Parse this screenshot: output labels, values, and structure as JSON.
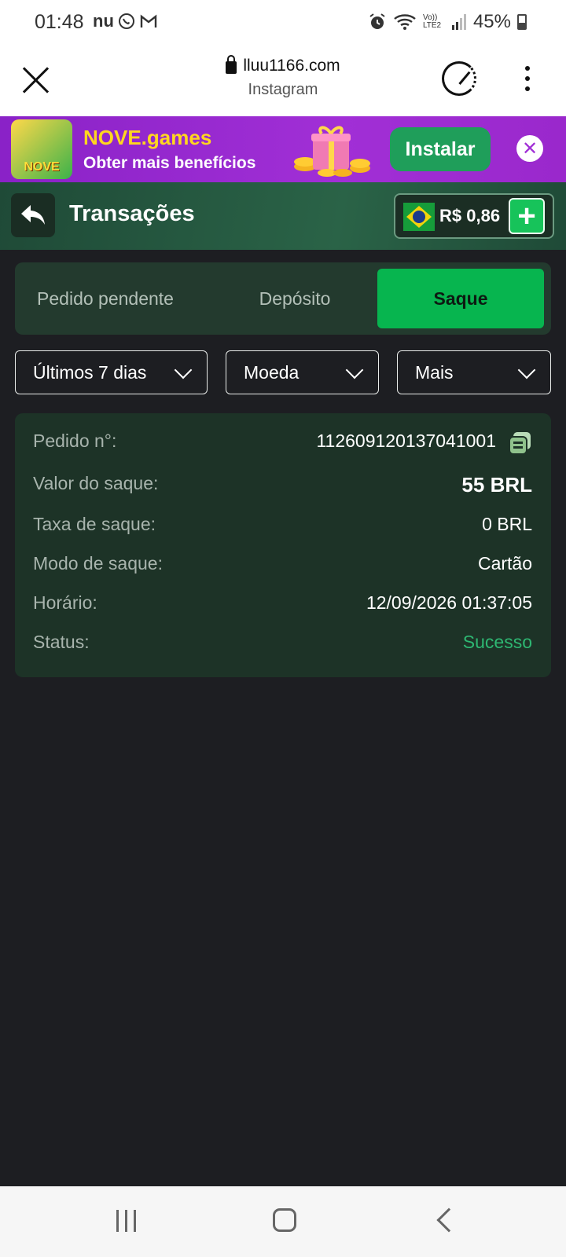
{
  "status_bar": {
    "time": "01:48",
    "left_icons": "nu",
    "lte_label": "Vo)) LTE2",
    "battery": "45%"
  },
  "browser": {
    "url": "lluu1166.com",
    "subtitle": "Instagram"
  },
  "promo": {
    "logo_text": "NOVE",
    "title": "NOVE.games",
    "subtitle": "Obter mais benefícios",
    "install_label": "Instalar"
  },
  "header": {
    "title": "Transações",
    "balance": "R$ 0,86"
  },
  "tabs": [
    {
      "label": "Pedido pendente"
    },
    {
      "label": "Depósito"
    },
    {
      "label": "Saque"
    }
  ],
  "filters": {
    "days": "Últimos 7 dias",
    "currency": "Moeda",
    "more": "Mais"
  },
  "transaction": {
    "order_label": "Pedido n°:",
    "order_value": "112609120137041001",
    "amount_label": "Valor do saque:",
    "amount_value": "55 BRL",
    "fee_label": "Taxa de saque:",
    "fee_value": "0 BRL",
    "mode_label": "Modo de saque:",
    "mode_value": "Cartão",
    "time_label": "Horário:",
    "time_value": "12/09/2026 01:37:05",
    "status_label": "Status:",
    "status_value": "Sucesso"
  },
  "colors": {
    "accent": "#07b54f",
    "success": "#2eb772",
    "background": "#1d1e22",
    "card": "#1d3327"
  }
}
